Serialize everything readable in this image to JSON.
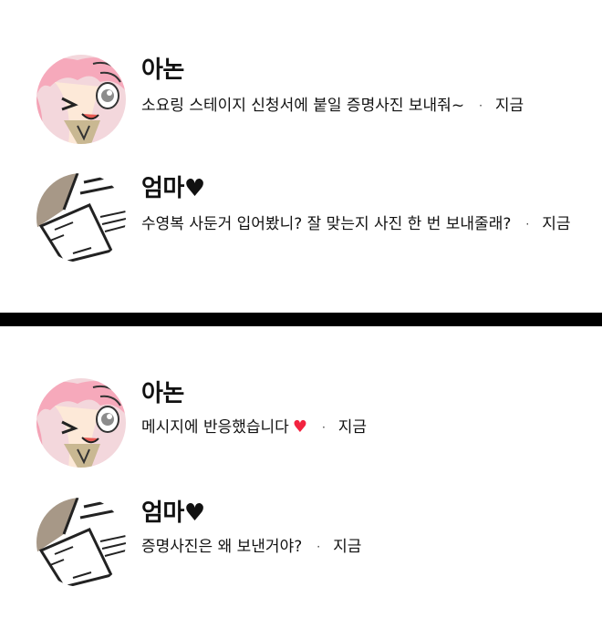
{
  "screens": [
    {
      "notifications": [
        {
          "sender": "아논",
          "message": "소요링 스테이지 신청서에 붙일 증명사진 보내줘~",
          "time": "지금",
          "avatar": "anime-girl-avatar"
        },
        {
          "sender": "엄마♥",
          "message": "수영복 사둔거 입어봤니? 잘 맞는지 사진 한 번 보내줄래?",
          "time": "지금",
          "avatar": "paper-document-avatar"
        }
      ]
    },
    {
      "notifications": [
        {
          "sender": "아논",
          "message": "메시지에 반응했습니다",
          "reaction": "♥",
          "time": "지금",
          "avatar": "anime-girl-avatar"
        },
        {
          "sender": "엄마♥",
          "message": "증명사진은 왜 보낸거야?",
          "time": "지금",
          "avatar": "paper-document-avatar"
        }
      ]
    }
  ],
  "separator": "·",
  "colors": {
    "background": "#ffffff",
    "divider": "#000000",
    "reaction_heart": "#f2233f",
    "text": "#111111"
  }
}
